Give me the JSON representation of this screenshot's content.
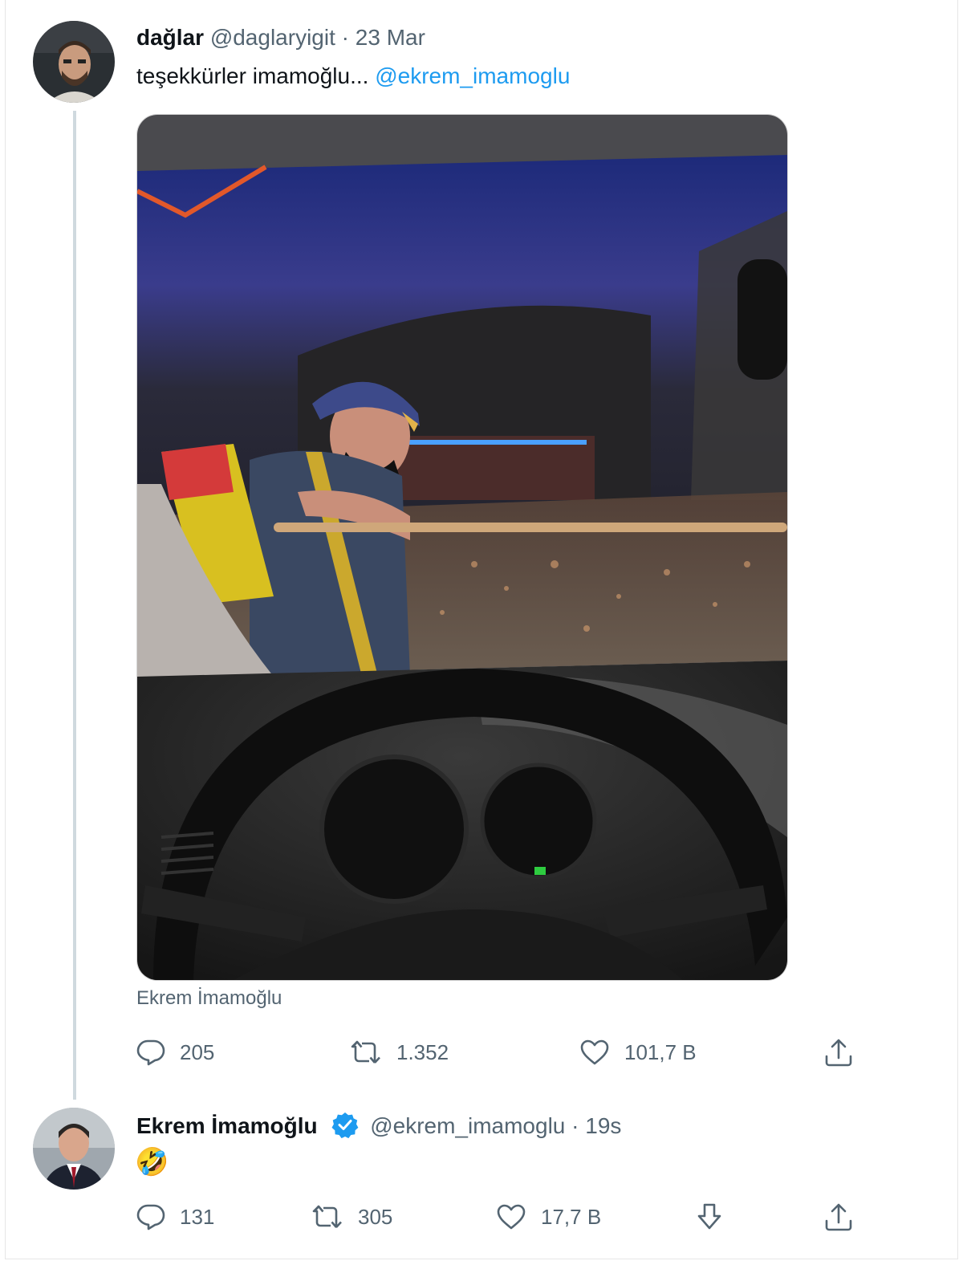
{
  "tweet1": {
    "display_name": "dağlar",
    "handle": "@daglaryigit",
    "separator": "·",
    "date": "23 Mar",
    "text": "teşekkürler imamoğlu...",
    "mention": "@ekrem_imamoglu",
    "media_caption": "Ekrem İmamoğlu",
    "stats": {
      "replies": "205",
      "retweets": "1.352",
      "likes": "101,7 B"
    }
  },
  "tweet2": {
    "display_name": "Ekrem İmamoğlu",
    "verified": true,
    "handle": "@ekrem_imamoglu",
    "separator": "·",
    "time": "19s",
    "emoji": "🤣",
    "stats": {
      "replies": "131",
      "retweets": "305",
      "likes": "17,7 B"
    }
  },
  "icons": [
    "reply-icon",
    "retweet-icon",
    "like-icon",
    "share-icon",
    "down-arrow-icon",
    "verified-badge-icon"
  ],
  "colors": {
    "link": "#1d9bf0",
    "muted": "#536471",
    "verified": "#1d9bf0",
    "thread_line": "#cfd9de"
  }
}
